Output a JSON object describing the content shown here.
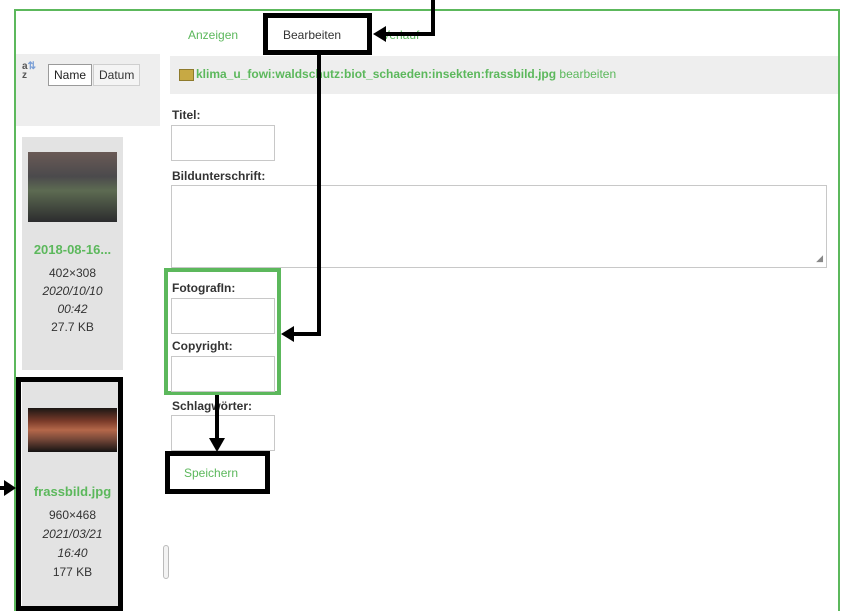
{
  "tabs": [
    {
      "label": "Anzeigen"
    },
    {
      "label": "Bearbeiten",
      "active": true
    },
    {
      "label": "Verlauf"
    }
  ],
  "sort": {
    "icon_top": "a",
    "icon_bottom": "z",
    "name_label": "Name",
    "date_label": "Datum"
  },
  "files": [
    {
      "name": "2018-08-16...",
      "dimensions": "402×308",
      "date": "2020/10/10",
      "time": "00:42",
      "size": "27.7 KB"
    },
    {
      "name": "frassbild.jpg",
      "dimensions": "960×468",
      "date": "2021/03/21",
      "time": "16:40",
      "size": "177 KB"
    }
  ],
  "path": {
    "text": "klima_u_fowi:waldschutz:biot_schaeden:insekten:frassbild.jpg",
    "edit_link": "bearbeiten"
  },
  "form": {
    "title_label": "Titel:",
    "caption_label": "Bildunterschrift:",
    "photographer_label": "FotografIn:",
    "copyright_label": "Copyright:",
    "keywords_label": "Schlagwörter:",
    "save_label": "Speichern"
  },
  "colors": {
    "accent": "#5cb85c",
    "highlight_box": "#000000"
  }
}
